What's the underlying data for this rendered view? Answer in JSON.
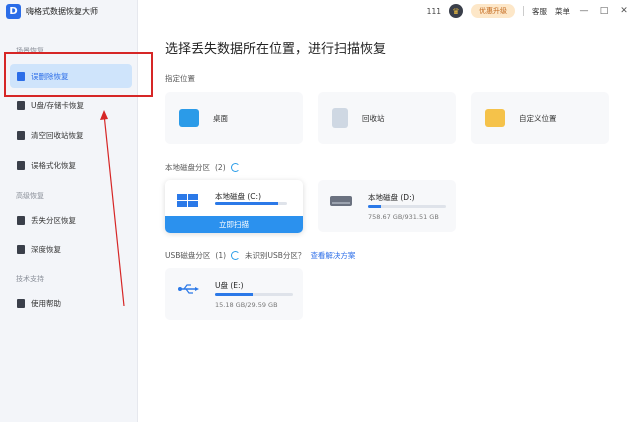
{
  "app": {
    "title": "嗨格式数据恢复大师"
  },
  "topbar": {
    "points": "111",
    "upgrade": "优惠升级",
    "service": "客服",
    "menu": "菜单",
    "minimize": "—",
    "maximize": "□",
    "close": "✕"
  },
  "sidebar": {
    "section1": "场景恢复",
    "section2": "高级恢复",
    "section3": "技术支持",
    "items": [
      {
        "label": "误删除恢复",
        "active": true
      },
      {
        "label": "U盘/存储卡恢复"
      },
      {
        "label": "清空回收站恢复"
      },
      {
        "label": "误格式化恢复"
      },
      {
        "label": "丢失分区恢复"
      },
      {
        "label": "深度恢复"
      },
      {
        "label": "使用帮助"
      }
    ]
  },
  "main": {
    "title": "选择丢失数据所在位置，进行扫描恢复",
    "locations_label": "指定位置",
    "locations": [
      {
        "label": "桌面",
        "icon": "desktop-icon",
        "color": "#2b9be8"
      },
      {
        "label": "回收站",
        "icon": "recycle-bin-icon",
        "color": "#cfd8e3"
      },
      {
        "label": "自定义位置",
        "icon": "folder-icon",
        "color": "#f5c24a"
      }
    ],
    "local_disk_label": "本地磁盘分区",
    "local_disk_count": "(2)",
    "disks": [
      {
        "name": "本地磁盘 (C:)",
        "usage": 0.88,
        "size": "",
        "scan": "立即扫描"
      },
      {
        "name": "本地磁盘 (D:)",
        "usage": 0.17,
        "size": "758.67 GB/931.51 GB"
      }
    ],
    "usb_label": "USB磁盘分区",
    "usb_count": "(1)",
    "usb_unrecognized": "未识别USB分区？",
    "usb_solution": "查看解决方案",
    "usb_disks": [
      {
        "name": "U盘 (E:)",
        "usage": 0.49,
        "size": "15.18 GB/29.59 GB"
      }
    ]
  }
}
